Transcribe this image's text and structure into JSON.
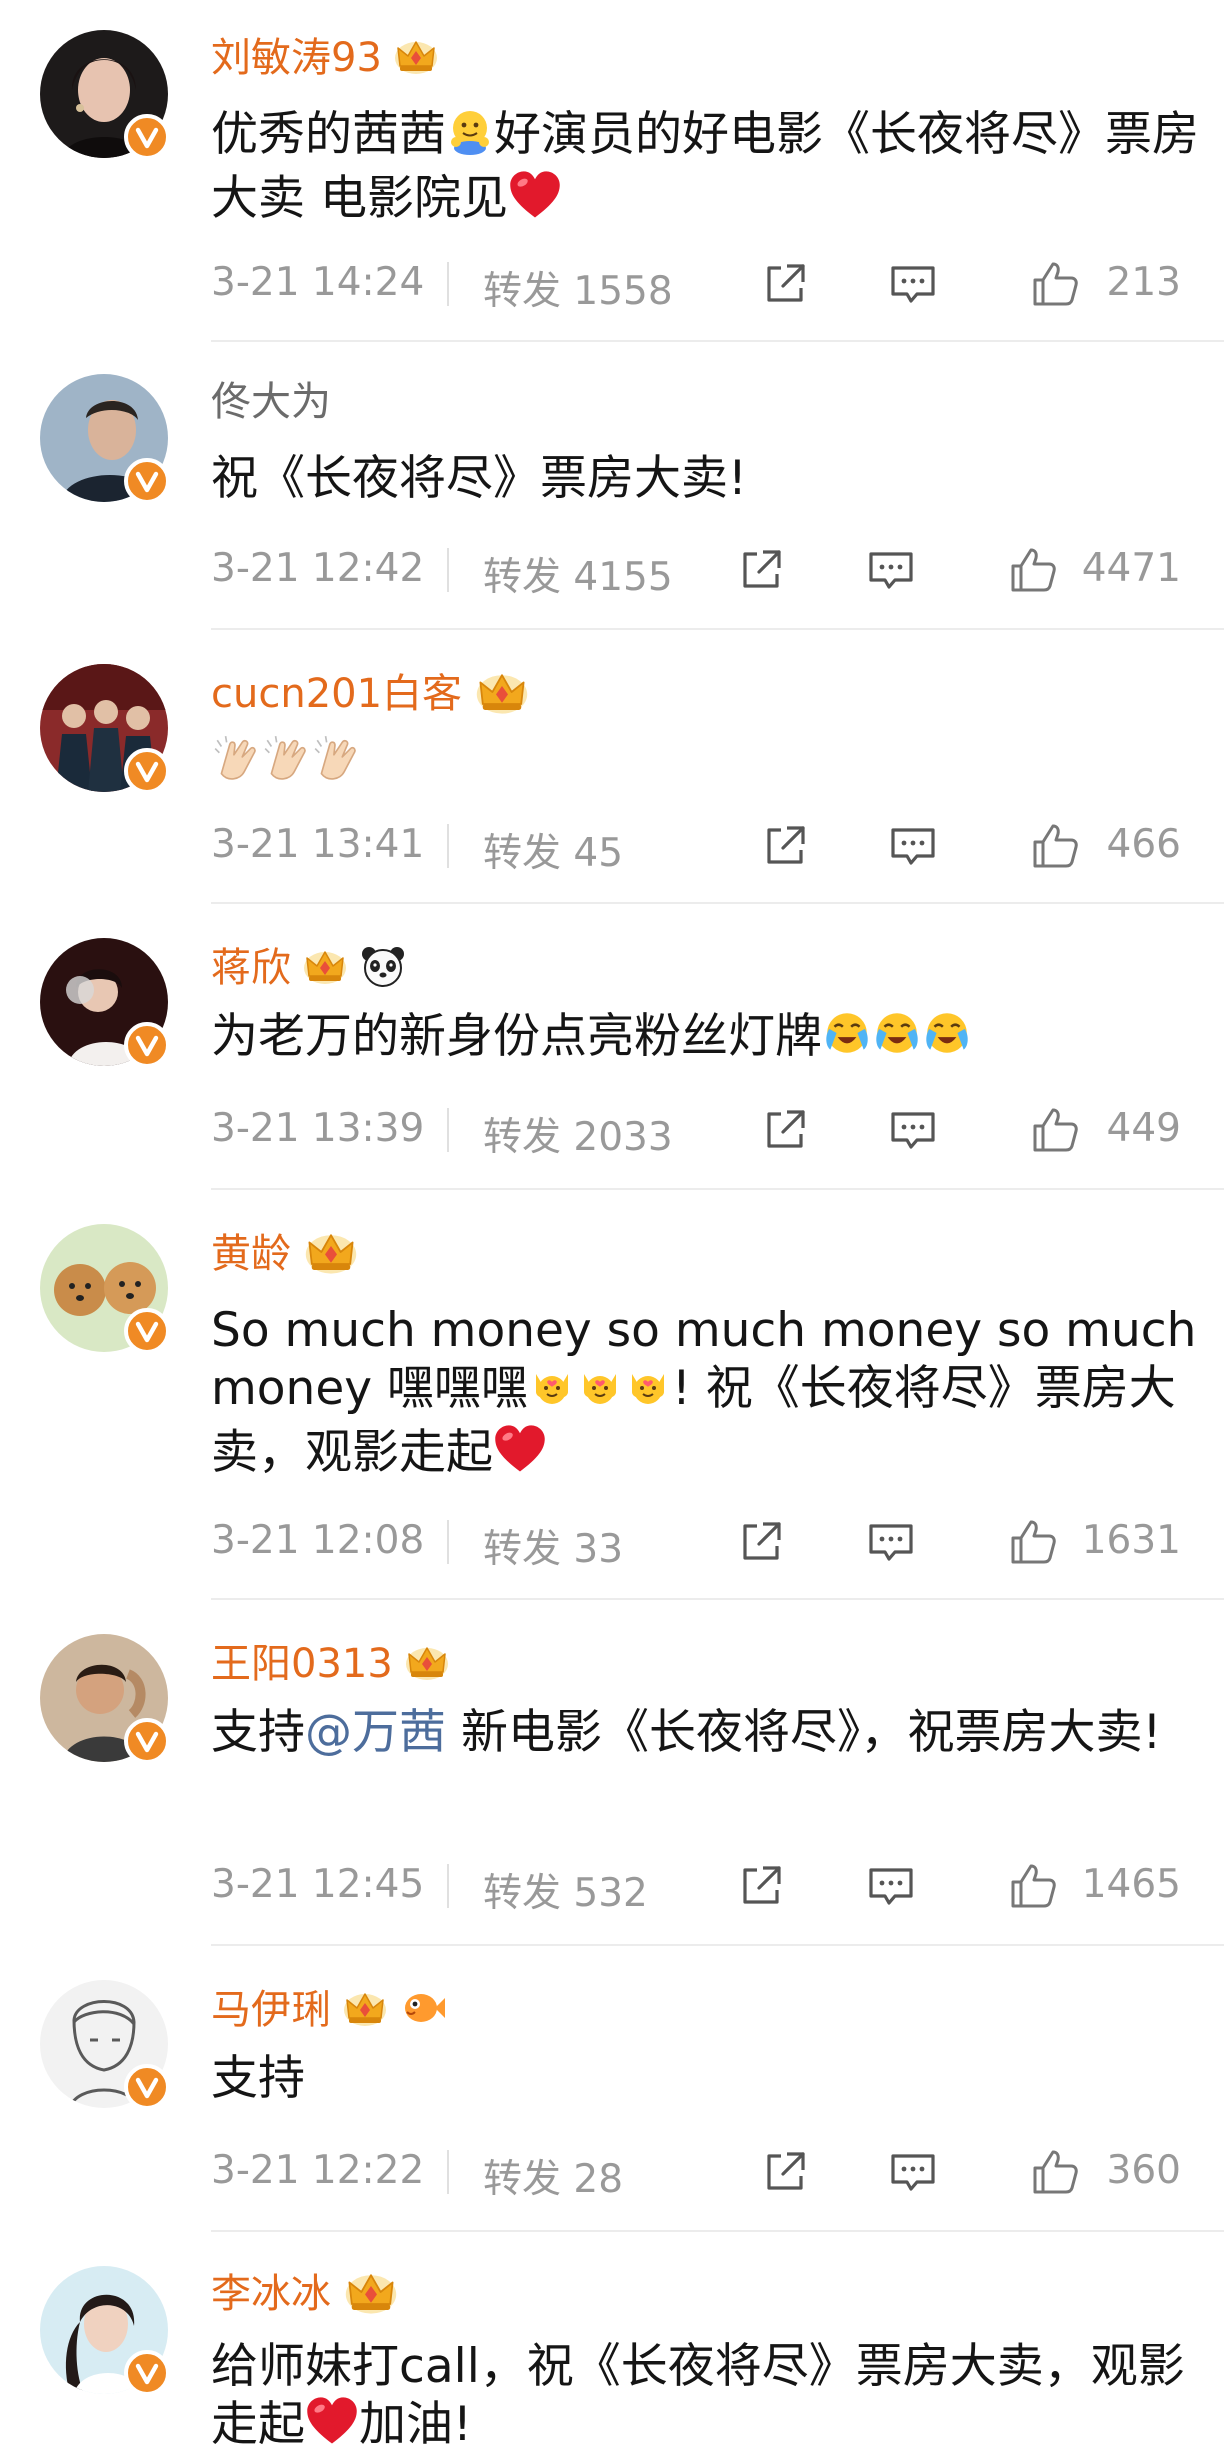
{
  "colors": {
    "vip_name": "#e36a1c",
    "plain_name": "#6b6b6b",
    "meta": "#999999",
    "mention": "#4d6d9c",
    "verified_badge": "#f08a24"
  },
  "comments": [
    {
      "name": "刘敏涛93",
      "text_part1": "优秀的茜茜",
      "text_part2": "好演员的好电影《长夜将尽》票房大卖 电影院见",
      "time": "3-21 14:24",
      "repost": "转发 1558",
      "likes": "213"
    },
    {
      "name": "佟大为",
      "text": "祝《长夜将尽》票房大卖!",
      "time": "3-21 12:42",
      "repost": "转发 4155",
      "likes": "4471"
    },
    {
      "name": "cucn201白客",
      "time": "3-21 13:41",
      "repost": "转发 45",
      "likes": "466"
    },
    {
      "name": "蒋欣",
      "text": "为老万的新身份点亮粉丝灯牌",
      "time": "3-21 13:39",
      "repost": "转发 2033",
      "likes": "449"
    },
    {
      "name": "黄龄",
      "text_part1": "So much money so much money so much money 嘿嘿嘿",
      "text_part2": "! 祝《长夜将尽》票房大卖，观影走起",
      "time": "3-21 12:08",
      "repost": "转发 33",
      "likes": "1631"
    },
    {
      "name": "王阳0313",
      "text_part1": "支持",
      "mention": "@万茜",
      "text_part2": " 新电影《长夜将尽》，祝票房大卖!",
      "time": "3-21 12:45",
      "repost": "转发 532",
      "likes": "1465"
    },
    {
      "name": "马伊琍",
      "text": "支持",
      "time": "3-21 12:22",
      "repost": "转发 28",
      "likes": "360"
    },
    {
      "name": "李冰冰",
      "text_part1": "给师妹打call，祝《长夜将尽》票房大卖，观影走起",
      "text_part2": "加油!"
    }
  ],
  "icons": {
    "share": "share-icon",
    "comment": "comment-icon",
    "like": "like-icon",
    "verified": "verified-badge-icon",
    "crown": "vip-crown-icon"
  }
}
